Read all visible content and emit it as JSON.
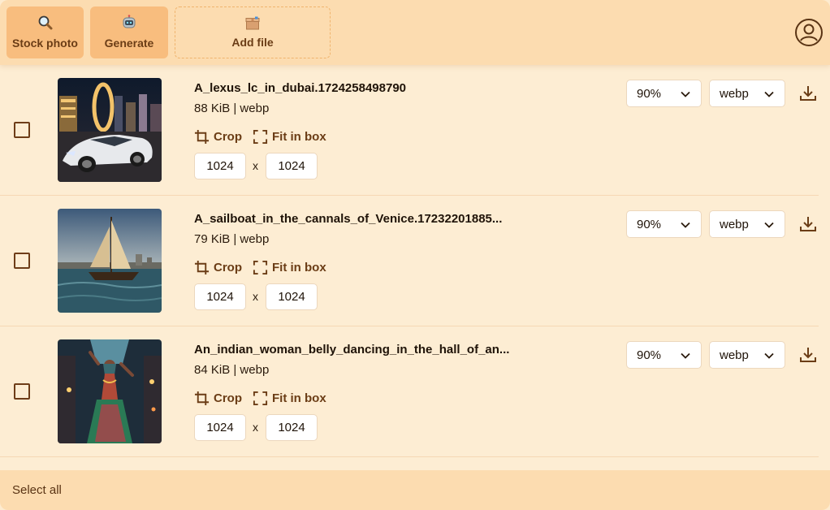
{
  "toolbar": {
    "stock_photo_label": "Stock photo",
    "generate_label": "Generate",
    "add_file_label": "Add file",
    "stock_photo_icon": "magnifier-icon",
    "generate_icon": "robot-icon",
    "add_file_icon": "package-icon",
    "account_icon": "user-circle-icon"
  },
  "files": [
    {
      "name": "A_lexus_lc_in_dubai.1724258498790",
      "meta": "88 KiB | webp",
      "crop_label": "Crop",
      "fit_label": "Fit in box",
      "width": "1024",
      "x_label": "x",
      "height": "1024",
      "quality": "90%",
      "format": "webp"
    },
    {
      "name": "A_sailboat_in_the_cannals_of_Venice.17232201885...",
      "meta": "79 KiB | webp",
      "crop_label": "Crop",
      "fit_label": "Fit in box",
      "width": "1024",
      "x_label": "x",
      "height": "1024",
      "quality": "90%",
      "format": "webp"
    },
    {
      "name": "An_indian_woman_belly_dancing_in_the_hall_of_an...",
      "meta": "84 KiB | webp",
      "crop_label": "Crop",
      "fit_label": "Fit in box",
      "width": "1024",
      "x_label": "x",
      "height": "1024",
      "quality": "90%",
      "format": "webp"
    }
  ],
  "footer": {
    "select_all_label": "Select all"
  },
  "colors": {
    "toolbar_bg": "#fcdcb0",
    "button_filled": "#f8bd7e",
    "accent_text": "#6b3d16",
    "page_bg": "#fdedd3"
  }
}
